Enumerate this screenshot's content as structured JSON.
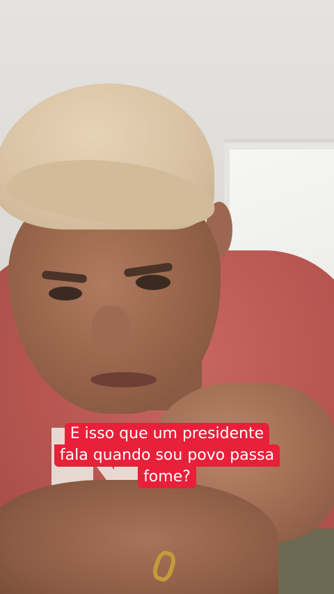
{
  "caption": {
    "lines": [
      "E isso que um presidente",
      "fala quando sou povo passa",
      "fome?"
    ],
    "background_color": "#e8203a",
    "text_color": "#ffffff"
  },
  "shirt_print_text": "NEW YO"
}
